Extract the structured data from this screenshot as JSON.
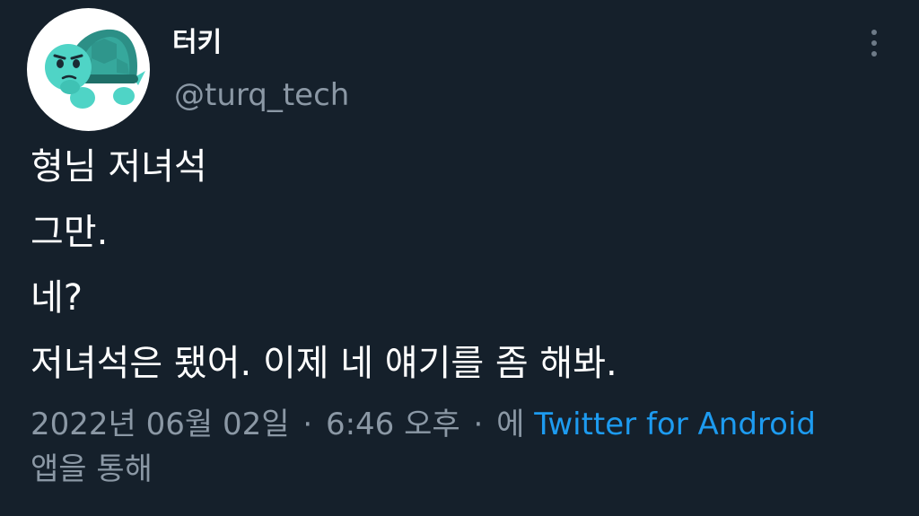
{
  "author": {
    "display_name": "터키",
    "handle": "@turq_tech",
    "avatar_icon": "turtle-avatar-icon"
  },
  "menu": {
    "icon": "more-vertical-icon"
  },
  "tweet": {
    "lines": [
      "형님 저녀석",
      "그만.",
      "네?",
      "저녀석은 됐어. 이제 네 얘기를 좀 해봐."
    ]
  },
  "meta": {
    "date": "2022년 06월 02일",
    "separator": "·",
    "time": "6:46 오후",
    "via_prefix": "에",
    "source": "Twitter for Android",
    "via_suffix": "앱을 통해"
  },
  "colors": {
    "background": "#15202b",
    "text_primary": "#ffffff",
    "text_secondary": "#8b98a5",
    "link": "#1d9bf0",
    "turtle_shell": "#2c8f86",
    "turtle_skin": "#4fd4c6"
  }
}
